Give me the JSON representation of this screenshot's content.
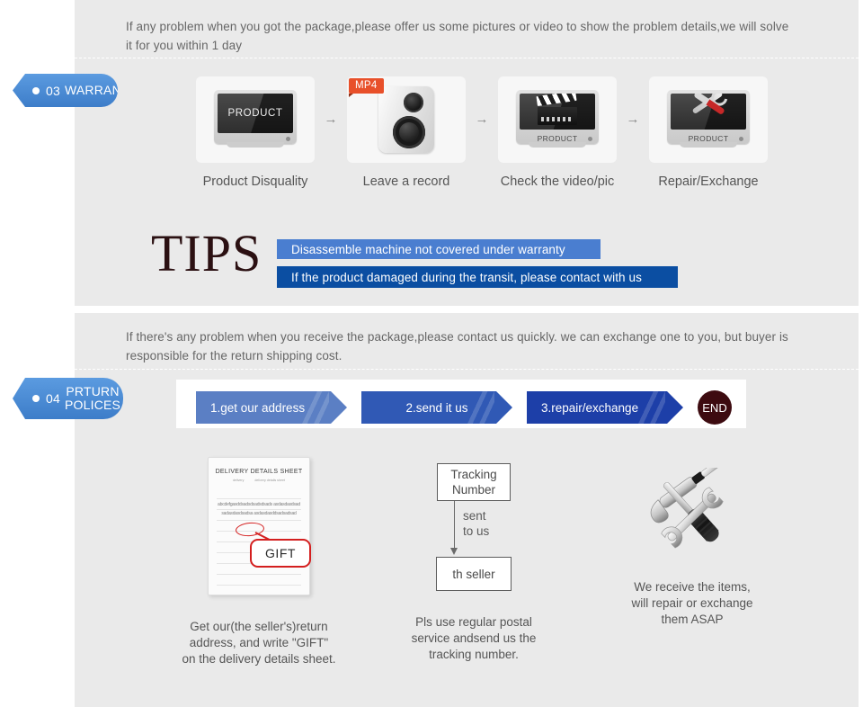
{
  "warranty_section": {
    "intro": "If any problem when you got the package,please offer us some pictures or video to show the problem details,we will solve\n it for you within 1 day",
    "badge": {
      "number": "03",
      "title": "WARRANTY"
    },
    "steps": [
      {
        "caption": "Product Disquality",
        "icon": "monitor-icon",
        "screen_label": "PRODUCT"
      },
      {
        "caption": "Leave a record",
        "icon": "camera-recorder-icon",
        "tag": "MP4"
      },
      {
        "caption": "Check the video/pic",
        "icon": "clapperboard-screen-icon",
        "screen_label": "PRODUCT"
      },
      {
        "caption": "Repair/Exchange",
        "icon": "tools-screen-icon",
        "screen_label": "PRODUCT"
      }
    ],
    "arrow_glyph": "→",
    "tips": {
      "heading": "TIPS",
      "bars": [
        {
          "text": "Disassemble machine not covered under warranty",
          "color": "#4a7ed0"
        },
        {
          "text": "If the product damaged during the transit, please contact with us",
          "color": "#0b4ea2"
        }
      ]
    }
  },
  "return_section": {
    "intro": "If  there's any problem when you receive the package,please contact us quickly. we can exchange one to you, but buyer is\nresponsible for the return shipping cost.",
    "badge": {
      "number": "04",
      "title": "PRTURN\nPOLICES"
    },
    "steps": [
      {
        "label": "1.get our address",
        "color": "#5b7fc4"
      },
      {
        "label": "2.send it us",
        "color": "#3059b5"
      },
      {
        "label": "3.repair/exchange",
        "color": "#1d3fa8"
      }
    ],
    "end_label": "END",
    "end_color": "#3d0b10",
    "columns": [
      {
        "caption": "Get our(the seller's)return\naddress, and write \"GIFT\"\non the delivery details sheet.",
        "sheet": {
          "title": "DELIVERY DETAILS SHEET",
          "sub_left": "delivery",
          "sub_right": "delivery details sheet",
          "filler": "abcdefgasddsadsdsadsdsads asdasdasdsadsadasdasdsadsa asdasdasddsadsadsad",
          "callout": "GIFT"
        }
      },
      {
        "caption": "Pls use regular postal\nservice andsend us the\ntracking number.",
        "flow": {
          "top_box": "Tracking\nNumber",
          "arrow_label": "sent\nto us",
          "bottom_box": "th seller"
        }
      },
      {
        "caption": "We receive the items,\nwill repair or exchange\n them ASAP",
        "icon": "hammer-wrench-screwdriver-icon"
      }
    ]
  }
}
